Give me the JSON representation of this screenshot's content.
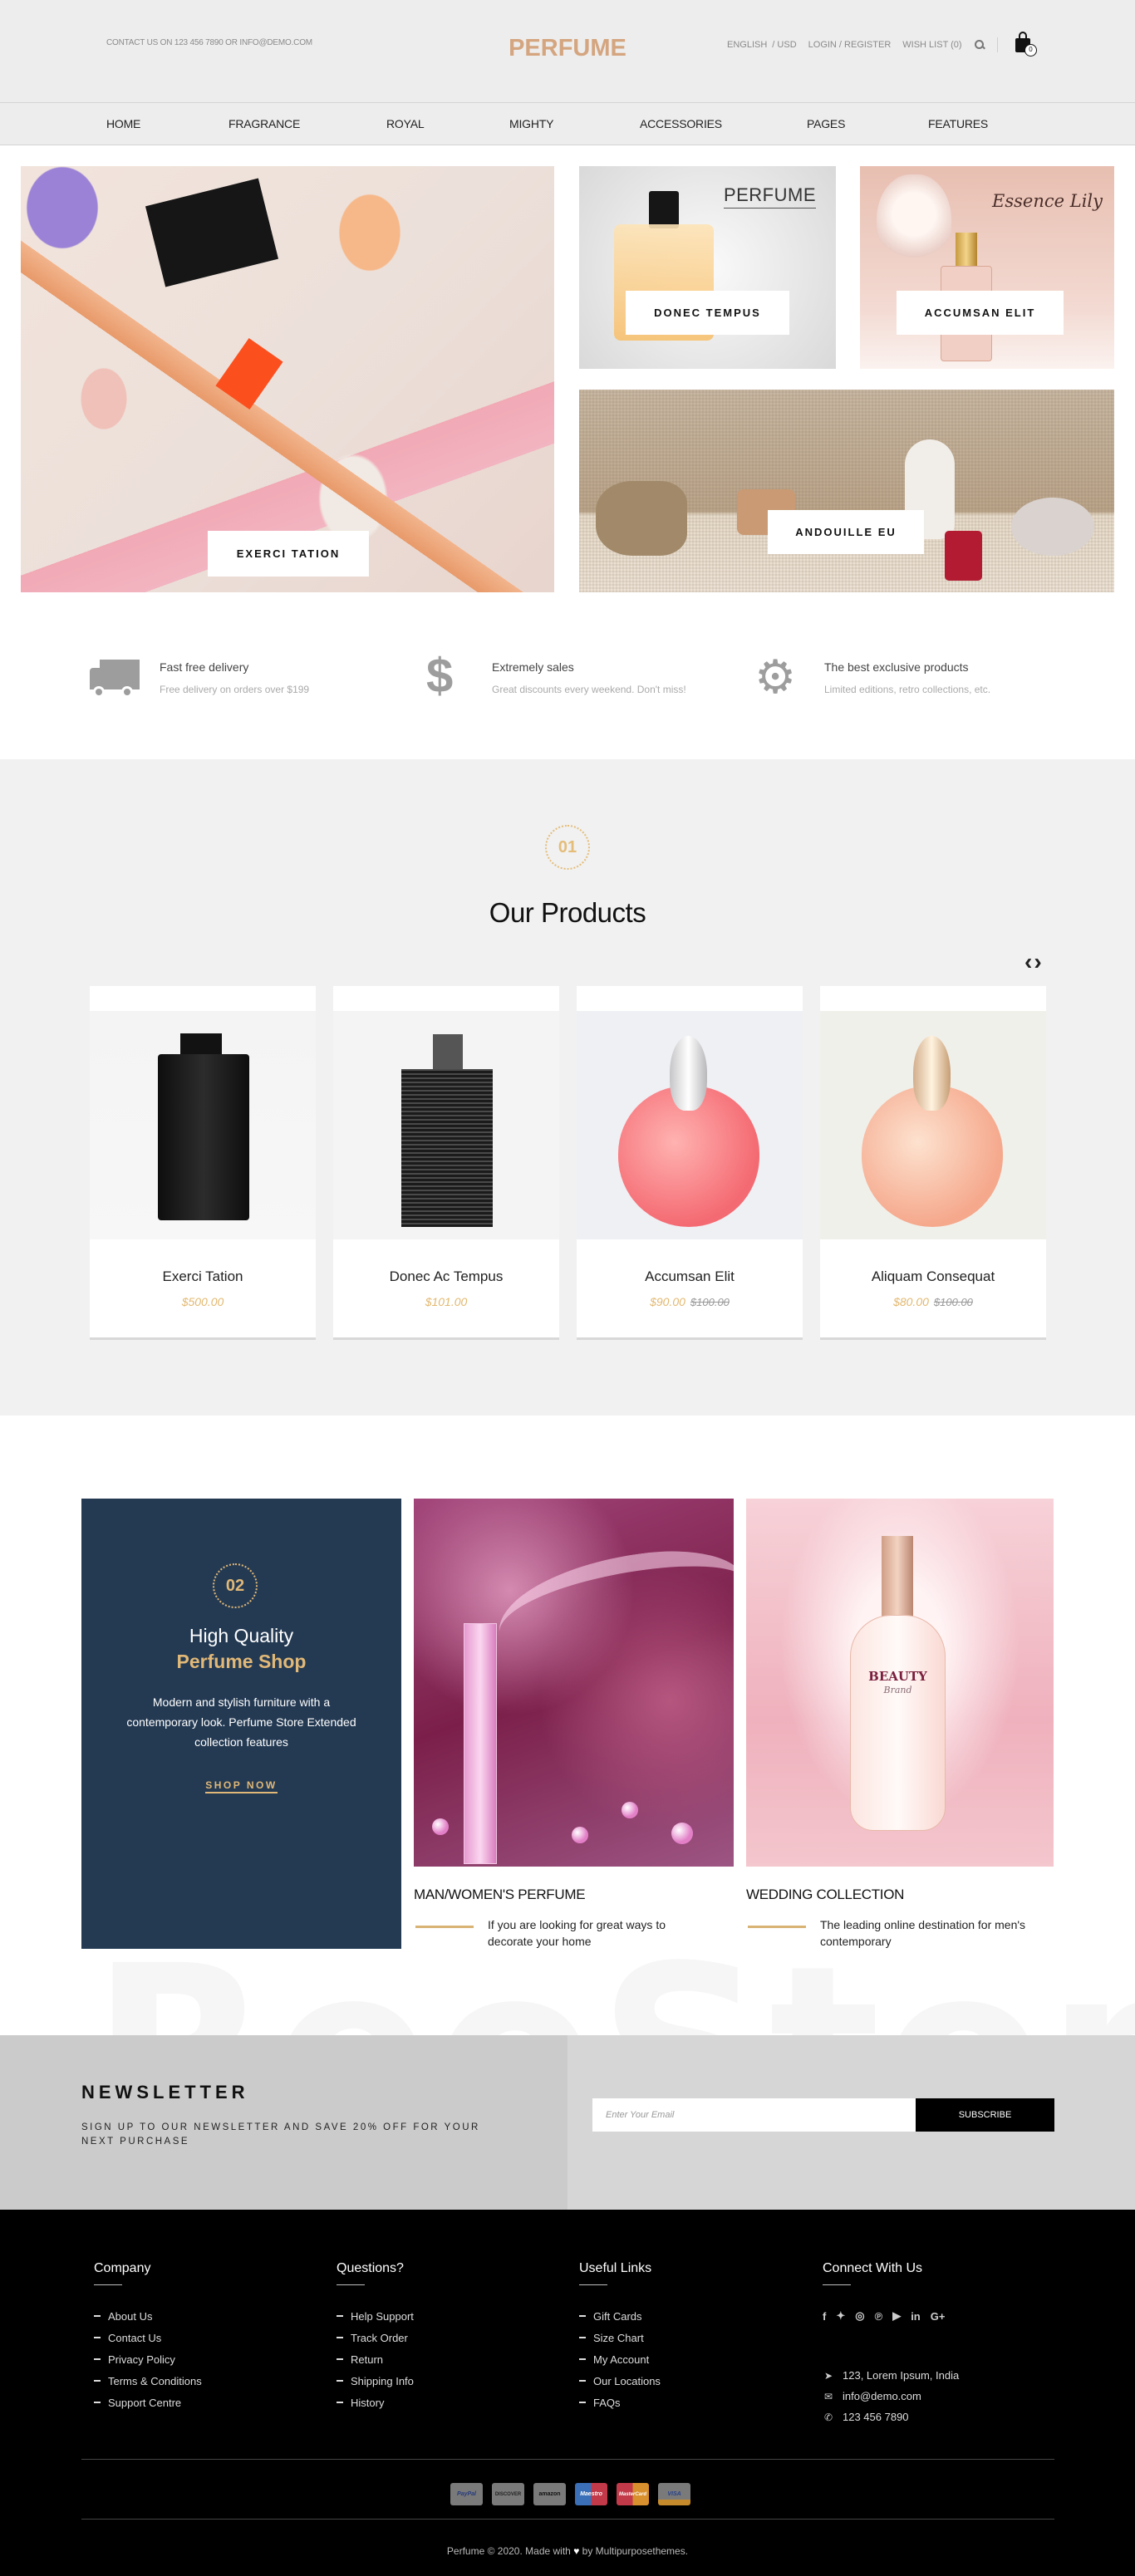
{
  "header": {
    "contact": "CONTACT US ON 123 456 7890 OR INFO@DEMO.COM",
    "logo": "PERFUME",
    "language": "ENGLISH",
    "currency": "/ USD",
    "login": "LOGIN / REGISTER",
    "wishlist": "WISH LIST (0)",
    "cart_count": "0",
    "accent_color": "#d4a57f"
  },
  "nav": {
    "items": [
      {
        "label": "HOME"
      },
      {
        "label": "FRAGRANCE"
      },
      {
        "label": "ROYAL"
      },
      {
        "label": "MIGHTY"
      },
      {
        "label": "ACCESSORIES"
      },
      {
        "label": "PAGES"
      },
      {
        "label": "FEATURES"
      }
    ]
  },
  "banners": [
    {
      "label": "EXERCI TATION"
    },
    {
      "label": "DONEC TEMPUS",
      "image_text": "PERFUME"
    },
    {
      "label": "ACCUMSAN ELIT",
      "image_text": "Essence Lily"
    },
    {
      "label": "ANDOUILLE EU"
    }
  ],
  "features": [
    {
      "icon": "truck-icon",
      "title": "Fast free delivery",
      "subtitle": "Free delivery on orders over $199"
    },
    {
      "icon": "dollar-icon",
      "title": "Extremely sales",
      "subtitle": "Great discounts every weekend. Don't miss!"
    },
    {
      "icon": "gear-icon",
      "title": "The best exclusive products",
      "subtitle": "Limited editions, retro collections, etc."
    }
  ],
  "products_section": {
    "badge": "01",
    "title": "Our Products",
    "prev_icon": "‹",
    "next_icon": "›",
    "items": [
      {
        "name": "Exerci Tation",
        "price": "$500.00",
        "old_price": ""
      },
      {
        "name": "Donec Ac Tempus",
        "price": "$101.00",
        "old_price": ""
      },
      {
        "name": "Accumsan Elit",
        "price": "$90.00",
        "old_price": "$100.00"
      },
      {
        "name": "Aliquam Consequat",
        "price": "$80.00",
        "old_price": "$100.00"
      }
    ],
    "price_color": "#e2b870"
  },
  "promo": {
    "badge": "02",
    "title_line1": "High Quality",
    "title_line2": "Perfume Shop",
    "description": "Modern and stylish furniture with a contemporary look. Perfume Store Extended collection features",
    "cta": "SHOP NOW",
    "card_color": "#243a53",
    "collections": [
      {
        "title": "MAN/WOMEN'S PERFUME",
        "description": "If you are looking for great ways to decorate your home"
      },
      {
        "title": "WEDDING COLLECTION",
        "description": "The leading online destination for men's contemporary",
        "image_text_1": "BEAUTY",
        "image_text_2": "Brand"
      }
    ],
    "watermark": "ReoStore"
  },
  "newsletter": {
    "title": "NEWSLETTER",
    "subtitle": "SIGN UP TO OUR NEWSLETTER AND SAVE 20% OFF FOR YOUR NEXT PURCHASE",
    "email_placeholder": "Enter Your Email",
    "email_value": "",
    "subscribe": "SUBSCRIBE"
  },
  "footer": {
    "columns": [
      {
        "title": "Company",
        "links": [
          "About Us",
          "Contact Us",
          "Privacy Policy",
          "Terms & Conditions",
          "Support Centre"
        ]
      },
      {
        "title": "Questions?",
        "links": [
          "Help Support",
          "Track Order",
          "Return",
          "Shipping Info",
          "History"
        ]
      },
      {
        "title": "Useful Links",
        "links": [
          "Gift Cards",
          "Size Chart",
          "My Account",
          "Our Locations",
          "FAQs"
        ]
      }
    ],
    "connect": {
      "title": "Connect With Us",
      "social": [
        {
          "icon": "facebook-icon",
          "glyph": "f"
        },
        {
          "icon": "twitter-icon",
          "glyph": "🐦"
        },
        {
          "icon": "instagram-icon",
          "glyph": "◎"
        },
        {
          "icon": "pinterest-icon",
          "glyph": "℗"
        },
        {
          "icon": "youtube-icon",
          "glyph": "▶"
        },
        {
          "icon": "linkedin-icon",
          "glyph": "in"
        },
        {
          "icon": "google-plus-icon",
          "glyph": "G+"
        }
      ],
      "address": "123, Lorem Ipsum, India",
      "email": "info@demo.com",
      "phone": "123 456 7890"
    },
    "payments": [
      "PayPal",
      "DISCOVER",
      "amazon",
      "Maestro",
      "MasterCard",
      "VISA"
    ],
    "copyright_prefix": "Perfume © 2020. Made with",
    "copyright_suffix": "by Multipurposethemes."
  }
}
